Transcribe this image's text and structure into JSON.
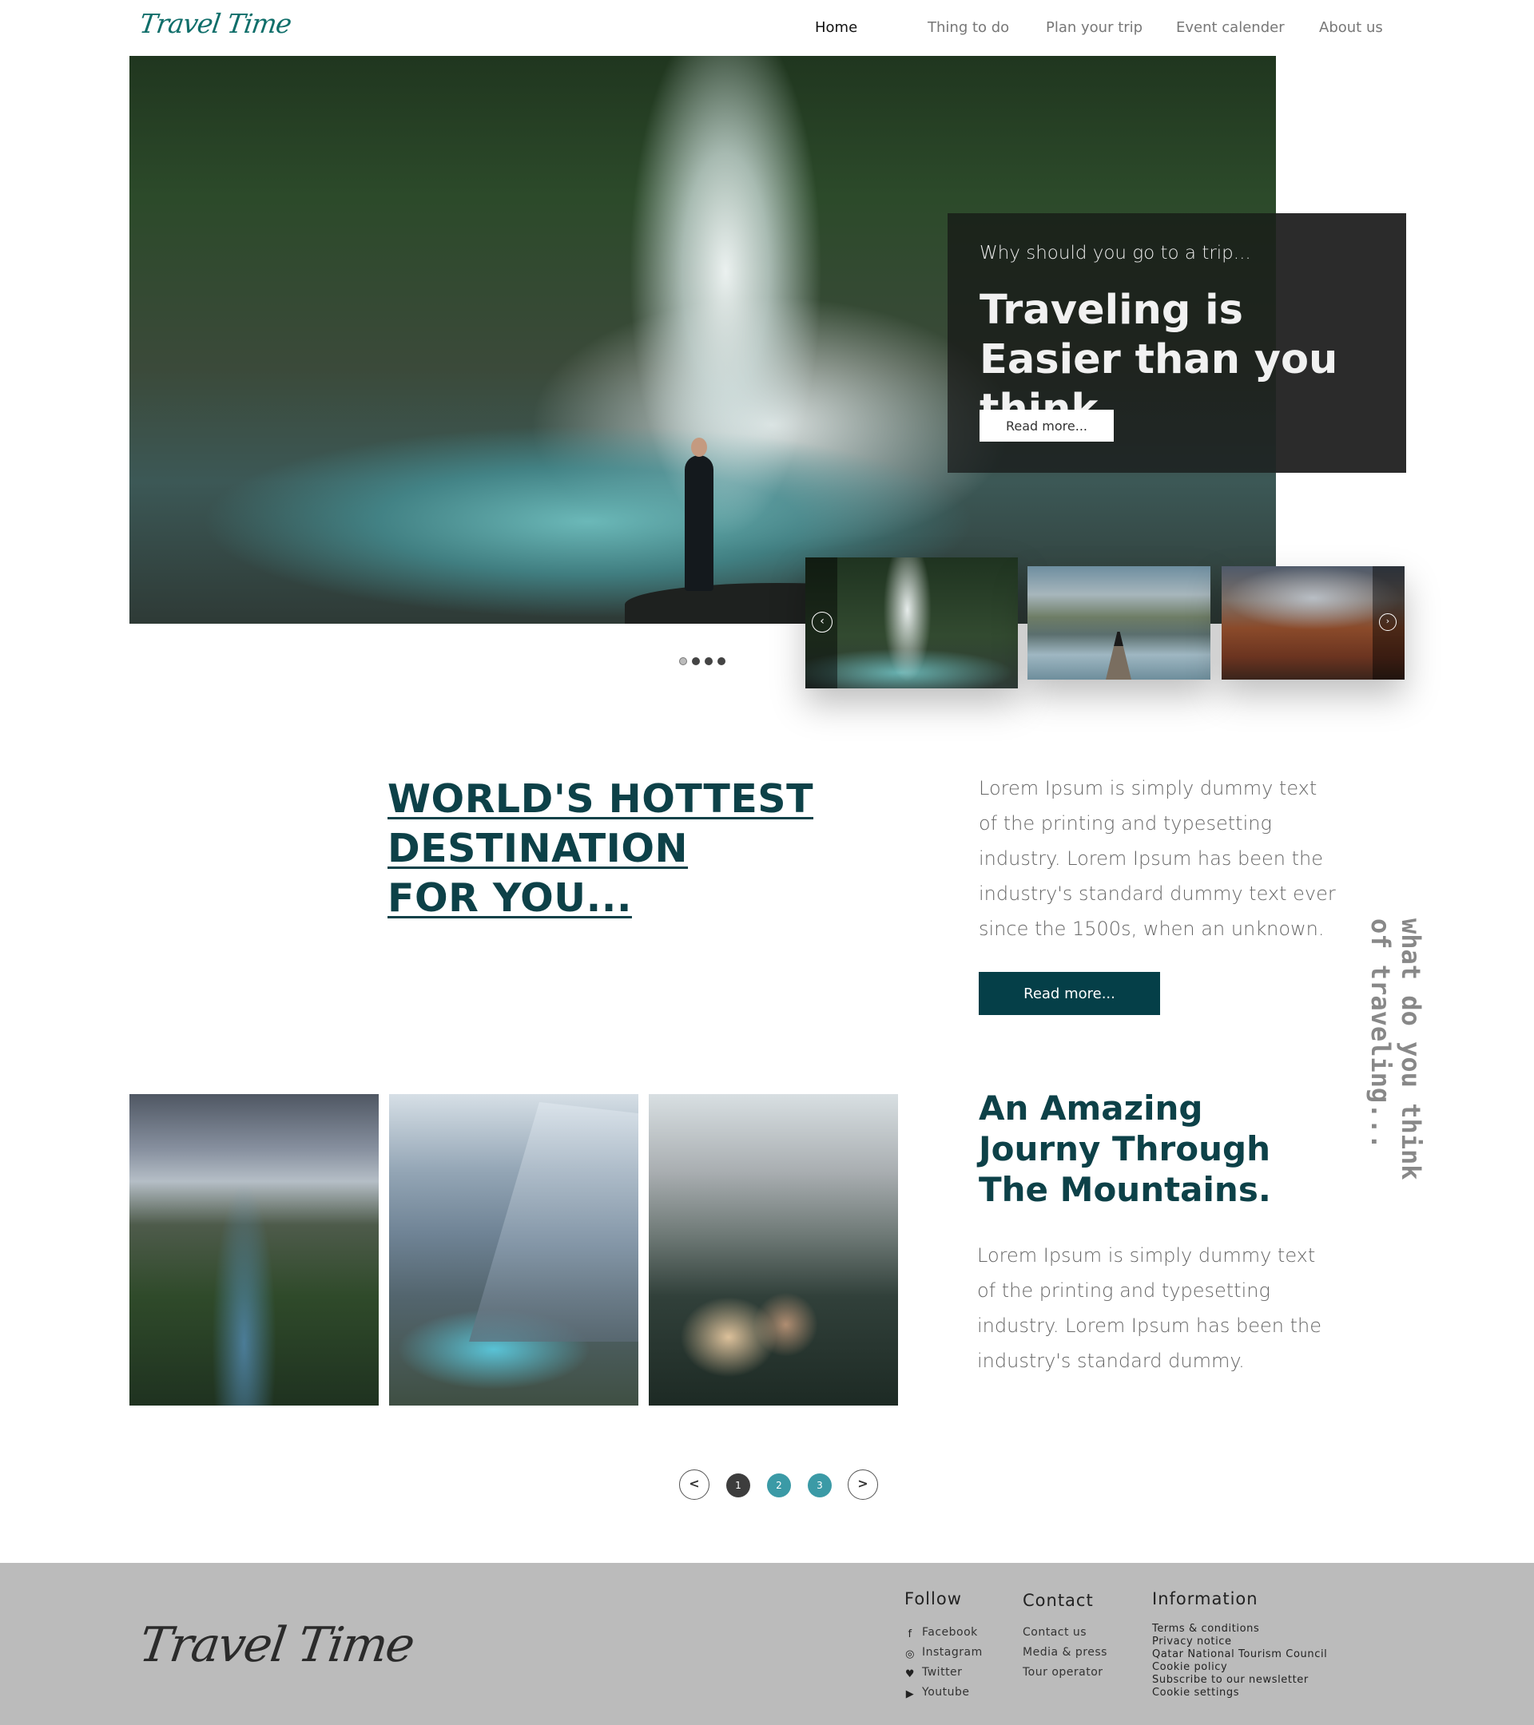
{
  "header": {
    "logo": "Travel Time",
    "nav": [
      {
        "label": "Home"
      },
      {
        "label": "Thing to do"
      },
      {
        "label": "Plan  your trip"
      },
      {
        "label": "Event calender"
      },
      {
        "label": "About us"
      }
    ]
  },
  "hero": {
    "subtitle": "Why should you go to a trip...",
    "title": "Traveling is Easier than you think.",
    "button": "Read more...",
    "prev_icon": "chevron-left-icon",
    "next_icon": "chevron-right-icon",
    "slide_dots": 4,
    "active_dot": 1
  },
  "destination": {
    "heading_lines": [
      "WORLD'S HOTTEST",
      "DESTINATION",
      "FOR YOU..."
    ],
    "paragraph": "Lorem Ipsum is simply dummy text of the printing and typesetting industry. Lorem Ipsum has been the industry's standard dummy text ever since the 1500s, when an unknown.",
    "button": "Read more...",
    "vertical_text": "what do you think of traveling..."
  },
  "journey": {
    "heading": "An Amazing Journy Through The Mountains.",
    "paragraph": "Lorem Ipsum is simply dummy text of the printing and typesetting industry. Lorem Ipsum has been the industry's standard dummy."
  },
  "pagination": {
    "prev": "<",
    "next": ">",
    "pages": [
      "1",
      "2",
      "3"
    ],
    "active_page": "1"
  },
  "colors": {
    "brand_teal": "#0d4148",
    "button_dark": "#053f48",
    "page_active": "#3d3d3d",
    "page_inactive": "#3b9aa6",
    "footer_bg": "#bbbbbb"
  },
  "footer": {
    "logo": "Travel Time",
    "follow": {
      "title": "Follow",
      "links": [
        {
          "label": "Facebook",
          "icon": "facebook-icon"
        },
        {
          "label": "Instagram",
          "icon": "instagram-icon"
        },
        {
          "label": "Twitter",
          "icon": "twitter-icon"
        },
        {
          "label": "Youtube",
          "icon": "youtube-icon"
        }
      ]
    },
    "contact": {
      "title": "Contact",
      "links": [
        "Contact us",
        "Media & press",
        "Tour operator"
      ]
    },
    "information": {
      "title": "Information",
      "links": [
        "Terms & conditions",
        "Privacy notice",
        "Qatar National Tourism Council",
        "Cookie policy",
        "Subscribe to our newsletter",
        "Cookie settings"
      ]
    }
  }
}
